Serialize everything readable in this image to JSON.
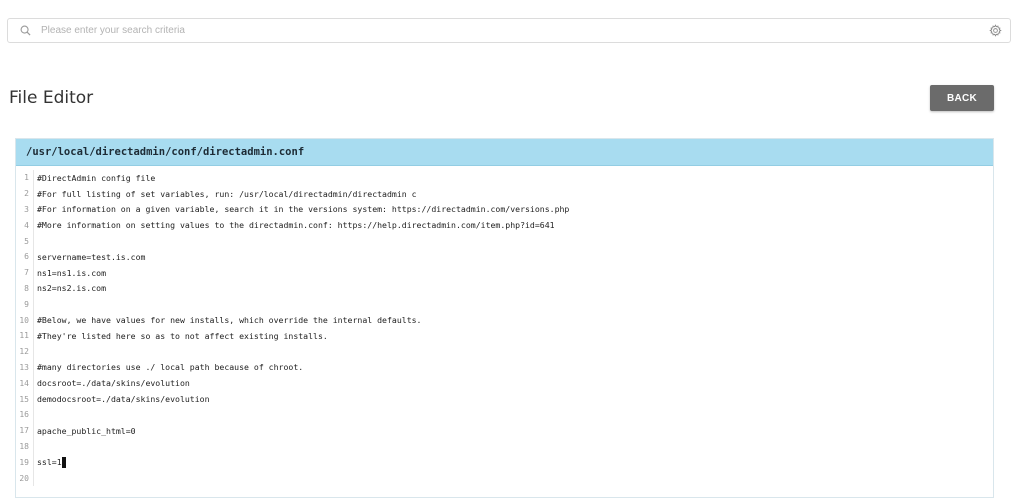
{
  "search": {
    "placeholder": "Please enter your search criteria",
    "icon": "search-icon",
    "settings_icon": "gear-icon"
  },
  "page": {
    "title": "File Editor",
    "back_label": "BACK"
  },
  "editor": {
    "file_path": "/usr/local/directadmin/conf/directadmin.conf",
    "header_color": "#a8dcf0",
    "lines": [
      {
        "n": "1",
        "text": "#DirectAdmin config file"
      },
      {
        "n": "2",
        "text": "#For full listing of set variables, run: /usr/local/directadmin/directadmin c"
      },
      {
        "n": "3",
        "text": "#For information on a given variable, search it in the versions system: https://directadmin.com/versions.php"
      },
      {
        "n": "4",
        "text": "#More information on setting values to the directadmin.conf: https://help.directadmin.com/item.php?id=641"
      },
      {
        "n": "5",
        "text": ""
      },
      {
        "n": "6",
        "text": "servername=test.is.com"
      },
      {
        "n": "7",
        "text": "ns1=ns1.is.com"
      },
      {
        "n": "8",
        "text": "ns2=ns2.is.com"
      },
      {
        "n": "9",
        "text": ""
      },
      {
        "n": "10",
        "text": "#Below, we have values for new installs, which override the internal defaults."
      },
      {
        "n": "11",
        "text": "#They're listed here so as to not affect existing installs."
      },
      {
        "n": "12",
        "text": ""
      },
      {
        "n": "13",
        "text": "#many directories use ./ local path because of chroot."
      },
      {
        "n": "14",
        "text": "docsroot=./data/skins/evolution"
      },
      {
        "n": "15",
        "text": "demodocsroot=./data/skins/evolution"
      },
      {
        "n": "16",
        "text": ""
      },
      {
        "n": "17",
        "text": "apache_public_html=0"
      },
      {
        "n": "18",
        "text": ""
      },
      {
        "n": "19",
        "text": "ssl=1"
      },
      {
        "n": "20",
        "text": ""
      }
    ]
  }
}
